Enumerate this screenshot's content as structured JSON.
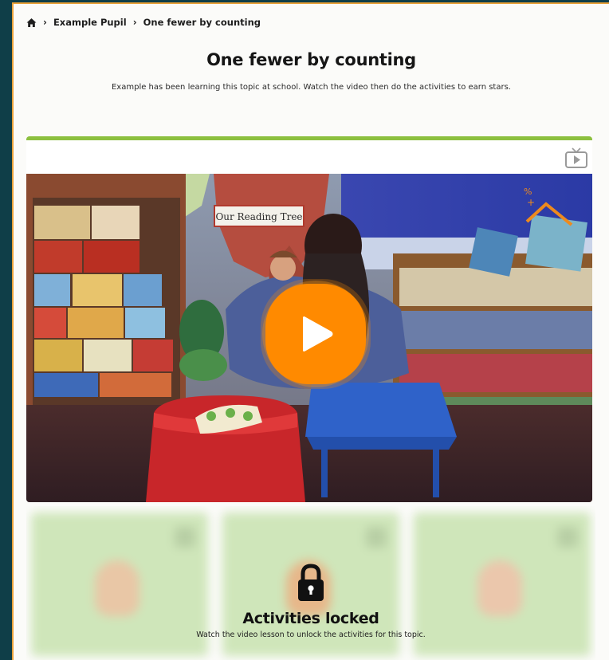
{
  "breadcrumb": {
    "home_icon": "home-icon",
    "items": [
      "Example Pupil",
      "One fewer by counting"
    ],
    "separator": "›"
  },
  "page": {
    "title": "One fewer by counting",
    "subtitle": "Example has been learning this topic at school. Watch the video then do the activities to earn stars."
  },
  "video": {
    "poster_sign": "Our Reading Tree",
    "tv_icon": "tv-play-icon",
    "play_icon": "play-icon"
  },
  "activities": {
    "locked_title": "Activities locked",
    "locked_text": "Watch the video lesson to unlock the activities for this topic.",
    "lock_icon": "lock-icon"
  },
  "colors": {
    "accent_green": "#8cc03f",
    "accent_orange": "#ff8a00",
    "frame_border": "#e9a23b",
    "background": "#0f3e48"
  }
}
